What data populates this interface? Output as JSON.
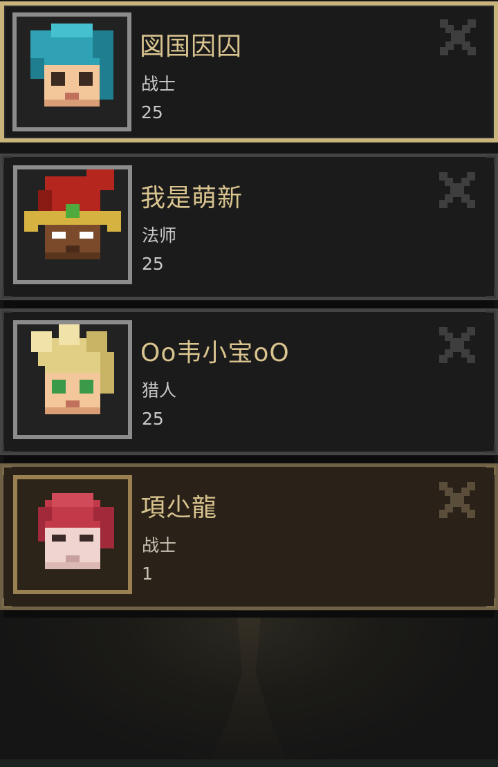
{
  "characters": [
    {
      "name": "図国因囚",
      "class": "战士",
      "level": "25",
      "avatar": "blue-hair-warrior-portrait",
      "selected": true
    },
    {
      "name": "我是萌新",
      "class": "法师",
      "level": "25",
      "avatar": "red-hat-mage-portrait",
      "selected": false
    },
    {
      "name": "Oo韦小宝oO",
      "class": "猎人",
      "level": "25",
      "avatar": "blonde-hunter-portrait",
      "selected": false
    },
    {
      "name": "項尐龍",
      "class": "战士",
      "level": "1",
      "avatar": "red-hair-warrior-portrait",
      "selected": false
    }
  ],
  "icons": {
    "delete": "close-x-icon"
  },
  "colors": {
    "selected_border": "#c9b57c",
    "name_text": "#d9c48f",
    "meta_text": "#c9c9c9",
    "card_bg": "#1b1b1b",
    "new_card_bg": "#2a2219"
  }
}
